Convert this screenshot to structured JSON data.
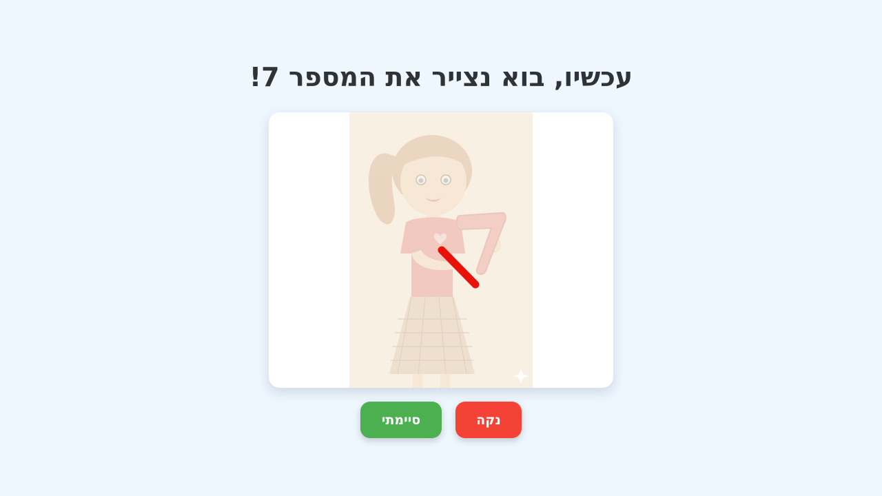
{
  "title": "עכשיו, בוא נצייר את המספר 7!",
  "buttons": {
    "done_label": "סיימתי",
    "clear_label": "נקה"
  },
  "colors": {
    "background": "#eef6fe",
    "done": "#4caf50",
    "clear": "#f44336",
    "stroke": "#e8120a"
  }
}
